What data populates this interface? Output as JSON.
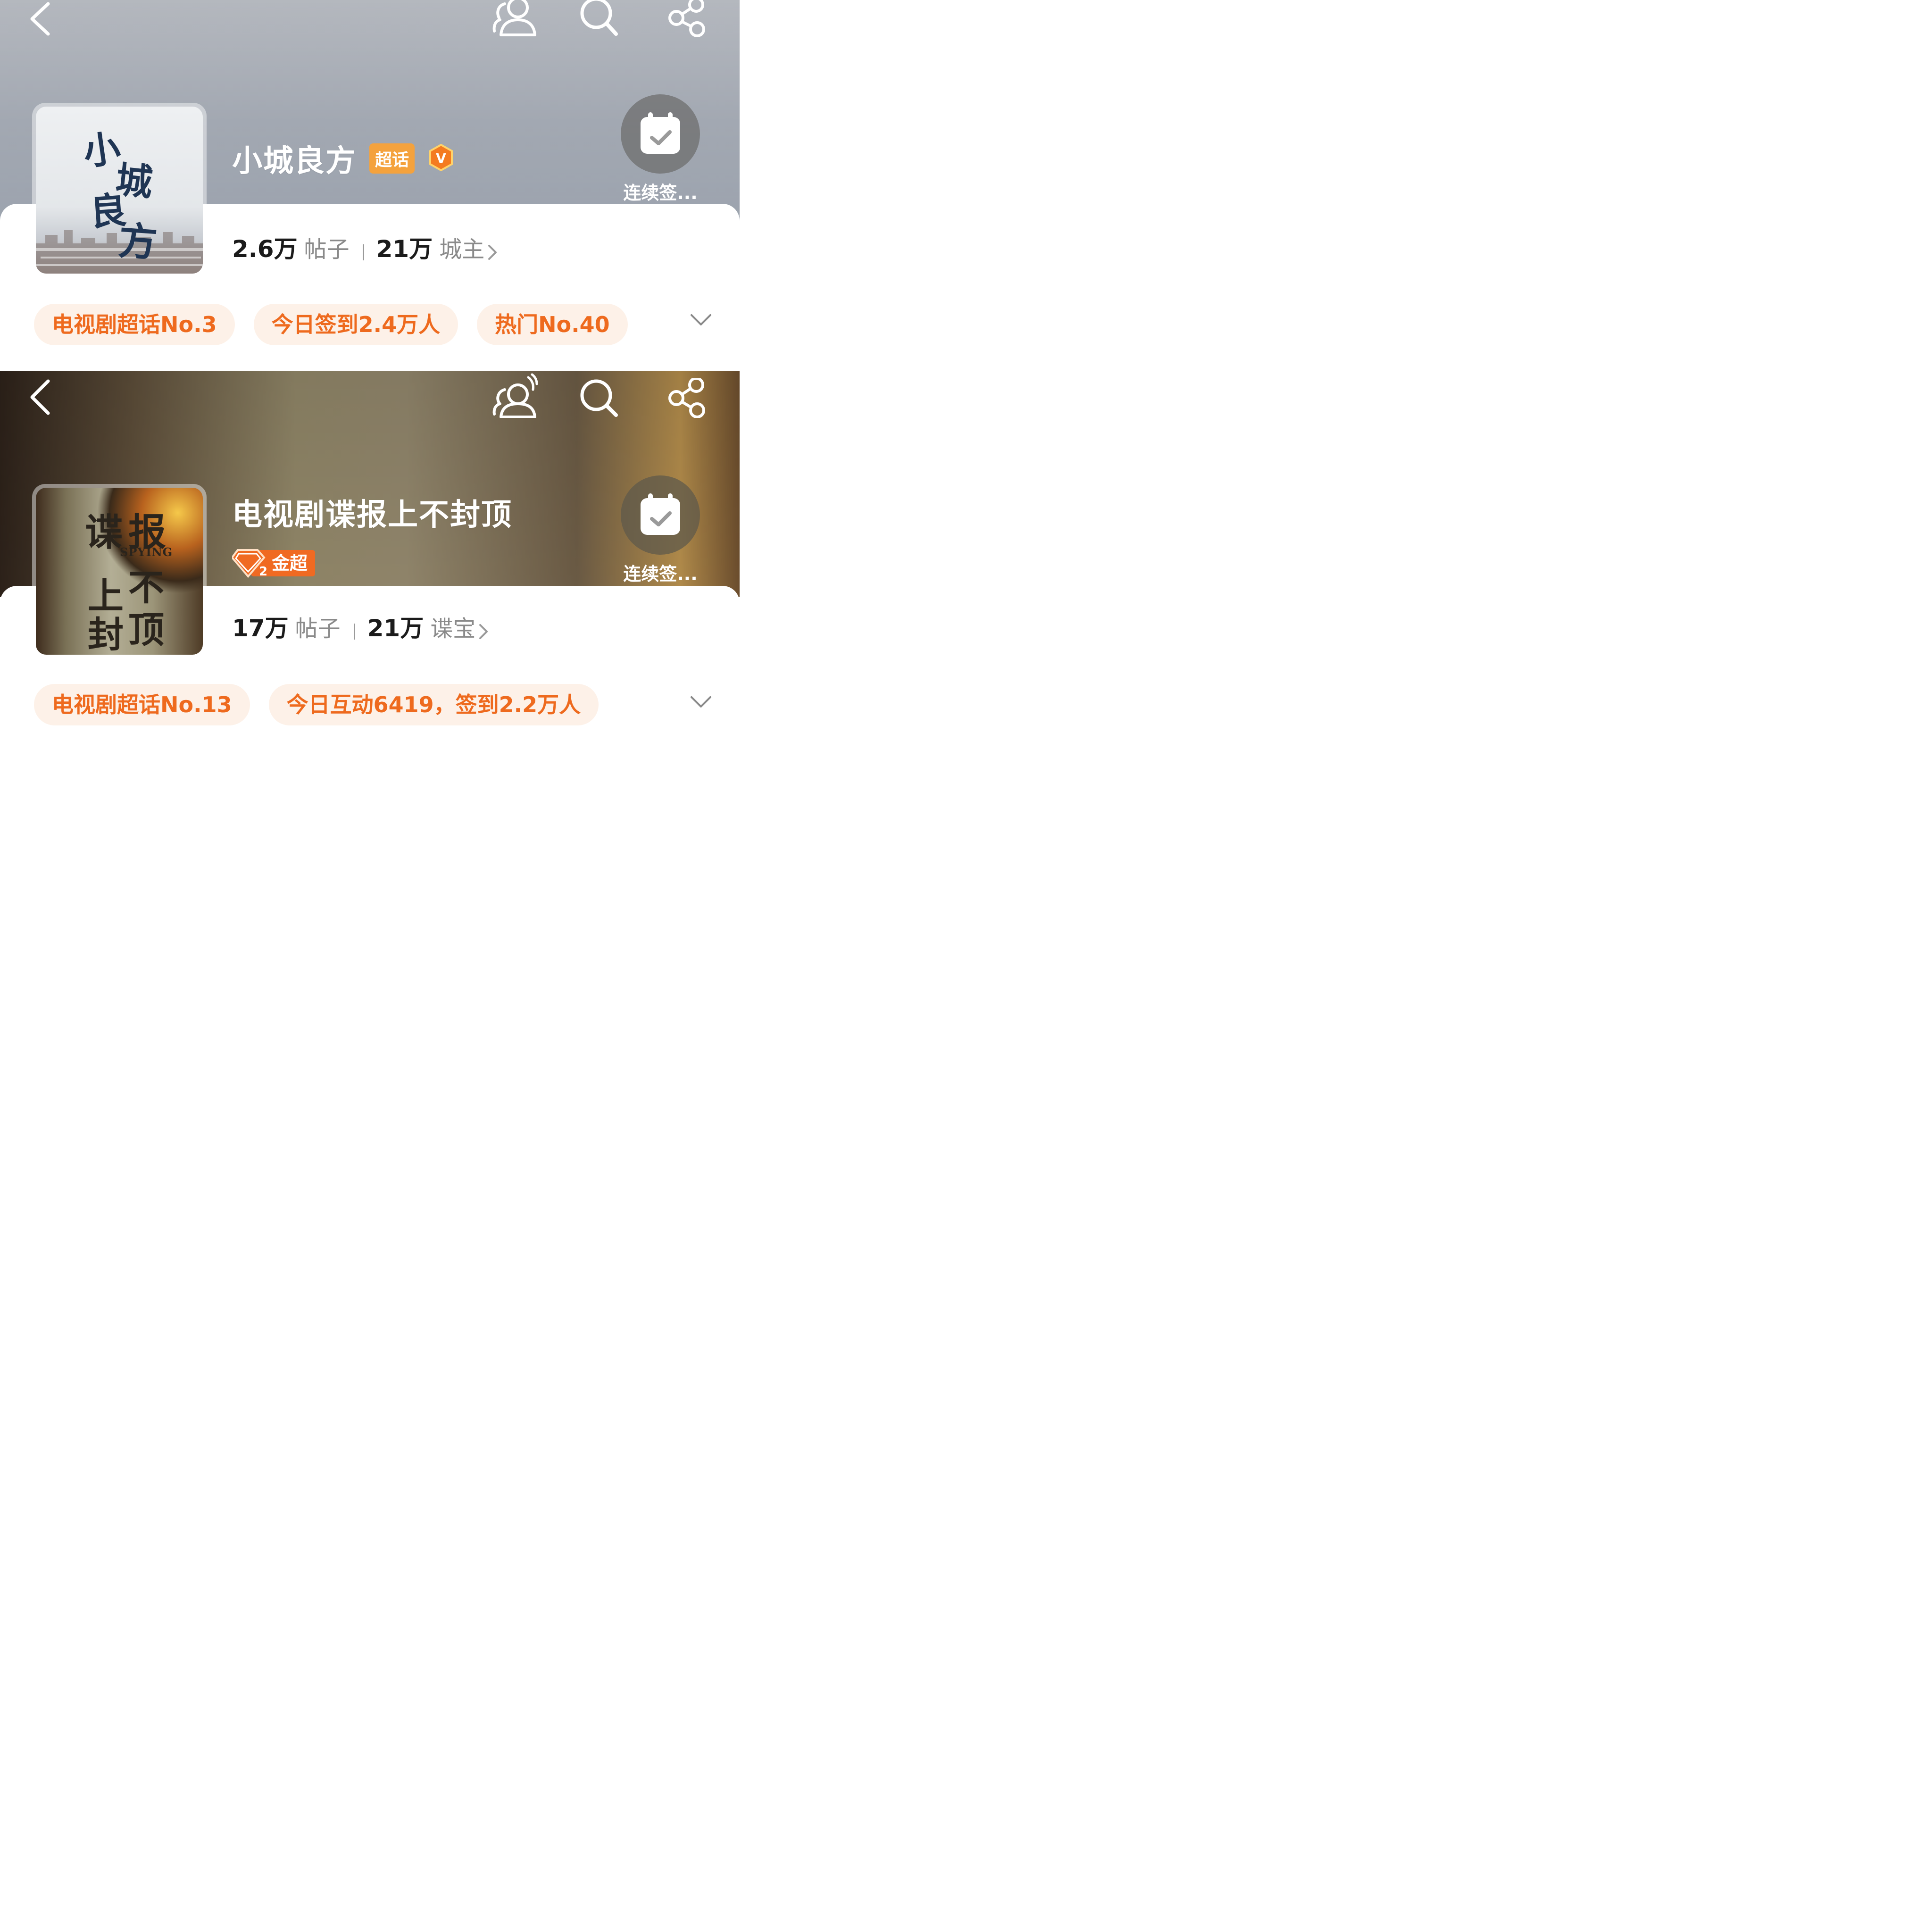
{
  "panels": [
    {
      "title": "小城良方",
      "badge": "超话",
      "verified_icon": "v-badge-icon",
      "checkin_label": "连续签...",
      "stats": {
        "posts_value": "2.6万",
        "posts_label": "帖子",
        "members_value": "21万",
        "members_label": "城主"
      },
      "chips": [
        "电视剧超话No.3",
        "今日签到2.4万人",
        "热门No.40"
      ],
      "cover_text": [
        "小",
        "城",
        "良",
        "方"
      ]
    },
    {
      "title": "电视剧谍报上不封顶",
      "badge_level": "2",
      "badge": "金超",
      "checkin_label": "连续签...",
      "stats": {
        "posts_value": "17万",
        "posts_label": "帖子",
        "members_value": "21万",
        "members_label": "谍宝"
      },
      "chips": [
        "电视剧超话No.13",
        "今日互动6419，签到2.2万人"
      ],
      "cover_text": [
        "谍",
        "报",
        "SPYING",
        "上",
        "不",
        "封",
        "顶"
      ]
    }
  ],
  "icons": {
    "back": "back-arrow-icon",
    "group": "group-chat-icon",
    "search": "search-icon",
    "share": "share-icon",
    "calendar": "calendar-check-icon",
    "chevron_right": "chevron-right-icon",
    "chevron_down": "chevron-down-icon"
  },
  "colors": {
    "accent_orange": "#ee6a1e",
    "chip_bg": "#fdf1e8",
    "badge_orange": "#f4a23d",
    "gold_badge": "#f06a22"
  }
}
